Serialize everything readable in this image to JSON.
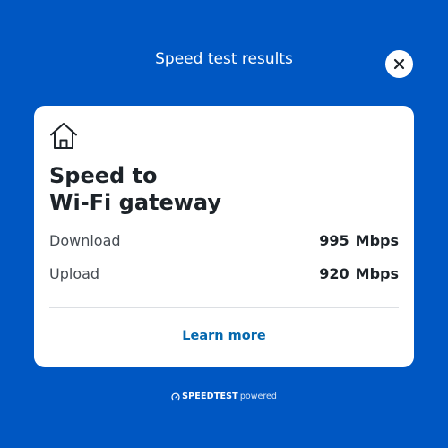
{
  "header": {
    "title": "Speed test results"
  },
  "close_button": {
    "icon": "close-icon"
  },
  "card": {
    "icon": "home-icon",
    "title_line1": "Speed to",
    "title_line2": "Wi-Fi gateway",
    "metrics": [
      {
        "label": "Download",
        "value": "995",
        "unit": "Mbps"
      },
      {
        "label": "Upload",
        "value": "920",
        "unit": "Mbps"
      }
    ],
    "link_label": "Learn more"
  },
  "footer": {
    "icon": "speedtest-gauge-icon",
    "brand": "SPEEDTEST",
    "suffix": "powered"
  },
  "colors": {
    "background": "#0057c2",
    "card": "#ffffff",
    "link": "#0568ae",
    "title_text": "#1d2329"
  }
}
